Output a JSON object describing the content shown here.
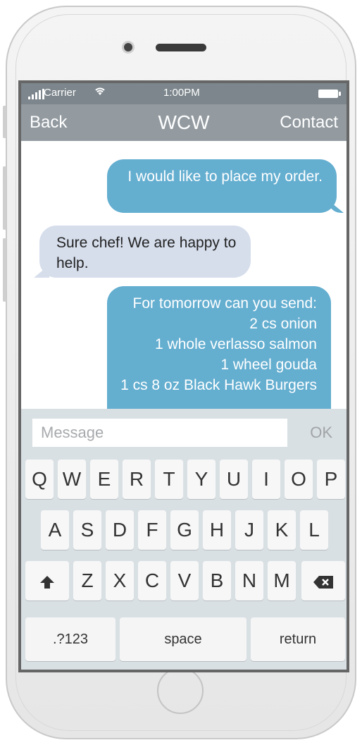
{
  "status_bar": {
    "carrier": "Carrier",
    "time": "1:00PM"
  },
  "nav": {
    "back": "Back",
    "title": "WCW",
    "contact": "Contact"
  },
  "messages": [
    {
      "direction": "out",
      "text": "I would like to place my order."
    },
    {
      "direction": "in",
      "text": "Sure chef! We are happy to help."
    },
    {
      "direction": "out",
      "lines": [
        "For tomorrow can you send:",
        "2 cs onion",
        "1 whole verlasso salmon",
        "1 wheel gouda",
        "1 cs 8 oz Black Hawk Burgers"
      ]
    }
  ],
  "composer": {
    "placeholder": "Message",
    "send": "OK"
  },
  "keyboard": {
    "row1": [
      "Q",
      "W",
      "E",
      "R",
      "T",
      "Y",
      "U",
      "I",
      "O",
      "P"
    ],
    "row2": [
      "A",
      "S",
      "D",
      "F",
      "G",
      "H",
      "J",
      "K",
      "L"
    ],
    "row3": [
      "Z",
      "X",
      "C",
      "V",
      "B",
      "N",
      "M"
    ],
    "numbers": ".?123",
    "space": "space",
    "return": "return"
  },
  "colors": {
    "outgoing_bubble": "#64aed0",
    "incoming_bubble": "#d6deec",
    "navbar": "#939ba1",
    "statusbar": "#7c868c"
  }
}
